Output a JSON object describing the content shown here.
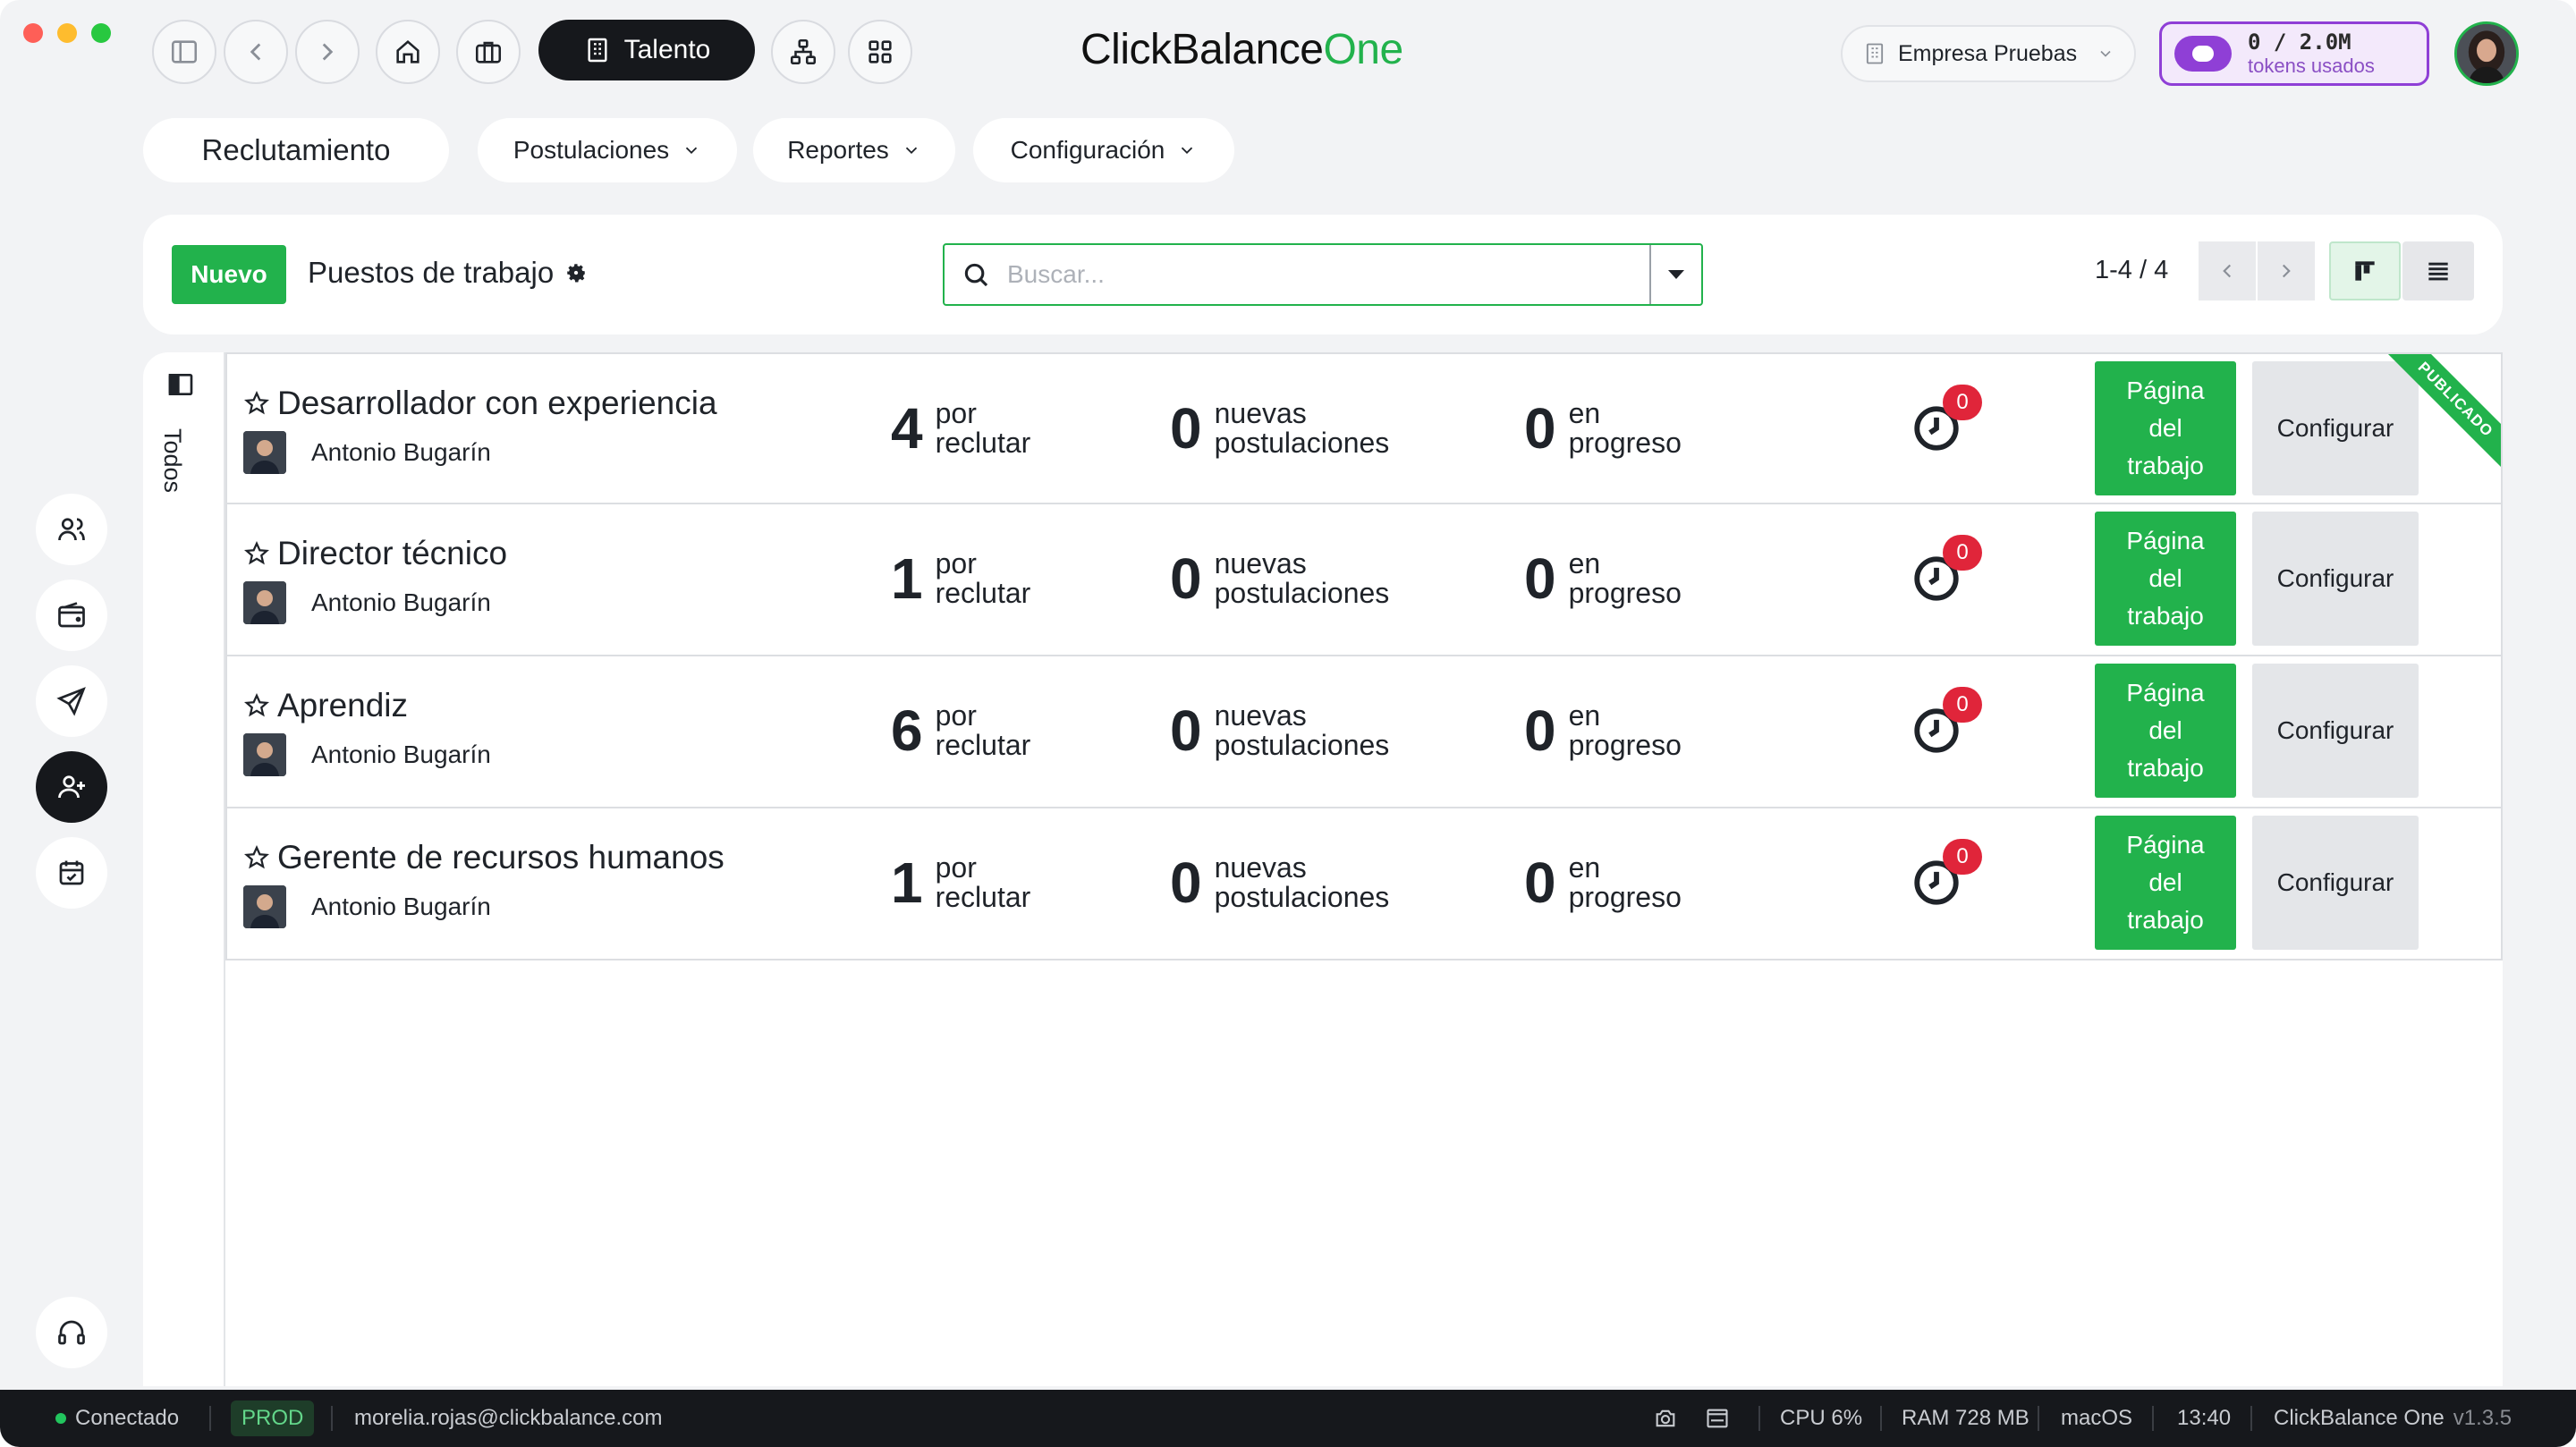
{
  "titlebar": {
    "app_tab_label": "Talento",
    "brand_main": "ClickBalance",
    "brand_suffix": "One",
    "company_name": "Empresa Pruebas",
    "tokens_count": "0 / 2.0M",
    "tokens_label": "tokens usados",
    "icons": [
      "sidebar-toggle-icon",
      "back-arrow-icon",
      "forward-arrow-icon",
      "home-icon",
      "briefcase-icon",
      "building-icon",
      "org-chart-icon",
      "apps-grid-icon",
      "chevron-down-icon"
    ]
  },
  "modulenav": {
    "main": "Reclutamiento",
    "items": [
      {
        "label": "Postulaciones"
      },
      {
        "label": "Reportes"
      },
      {
        "label": "Configuración"
      }
    ]
  },
  "control": {
    "new_button": "Nuevo",
    "breadcrumb": "Puestos de trabajo",
    "search_placeholder": "Buscar...",
    "pager": "1-4 / 4"
  },
  "sidefilter": {
    "label": "Todos"
  },
  "jobs": [
    {
      "title": "Desarrollador con experiencia",
      "recruiter": "Antonio Bugarín",
      "to_recruit": "4",
      "to_recruit_label_1": "por",
      "to_recruit_label_2": "reclutar",
      "new_applications": "0",
      "new_applications_label_1": "nuevas",
      "new_applications_label_2": "postulaciones",
      "in_progress": "0",
      "in_progress_label_1": "en",
      "in_progress_label_2": "progreso",
      "activity_count": "0",
      "page_button_1": "Página",
      "page_button_2": "del",
      "page_button_3": "trabajo",
      "config_button": "Configurar",
      "ribbon": "PUBLICADO"
    },
    {
      "title": "Director técnico",
      "recruiter": "Antonio Bugarín",
      "to_recruit": "1",
      "to_recruit_label_1": "por",
      "to_recruit_label_2": "reclutar",
      "new_applications": "0",
      "new_applications_label_1": "nuevas",
      "new_applications_label_2": "postulaciones",
      "in_progress": "0",
      "in_progress_label_1": "en",
      "in_progress_label_2": "progreso",
      "activity_count": "0",
      "page_button_1": "Página",
      "page_button_2": "del",
      "page_button_3": "trabajo",
      "config_button": "Configurar"
    },
    {
      "title": "Aprendiz",
      "recruiter": "Antonio Bugarín",
      "to_recruit": "6",
      "to_recruit_label_1": "por",
      "to_recruit_label_2": "reclutar",
      "new_applications": "0",
      "new_applications_label_1": "nuevas",
      "new_applications_label_2": "postulaciones",
      "in_progress": "0",
      "in_progress_label_1": "en",
      "in_progress_label_2": "progreso",
      "activity_count": "0",
      "page_button_1": "Página",
      "page_button_2": "del",
      "page_button_3": "trabajo",
      "config_button": "Configurar"
    },
    {
      "title": "Gerente de recursos humanos",
      "recruiter": "Antonio Bugarín",
      "to_recruit": "1",
      "to_recruit_label_1": "por",
      "to_recruit_label_2": "reclutar",
      "new_applications": "0",
      "new_applications_label_1": "nuevas",
      "new_applications_label_2": "postulaciones",
      "in_progress": "0",
      "in_progress_label_1": "en",
      "in_progress_label_2": "progreso",
      "activity_count": "0",
      "page_button_1": "Página",
      "page_button_2": "del",
      "page_button_3": "trabajo",
      "config_button": "Configurar"
    }
  ],
  "rail": {
    "icons": [
      "users-icon",
      "wallet-icon",
      "plane-icon",
      "user-plus-icon",
      "calendar-check-icon",
      "headset-icon"
    ]
  },
  "statusbar": {
    "connection": "Conectado",
    "environment": "PROD",
    "user_email": "morelia.rojas@clickbalance.com",
    "cpu": "CPU 6%",
    "ram": "RAM 728 MB",
    "os": "macOS",
    "time": "13:40",
    "app_name": "ClickBalance One",
    "version": "v1.3.5"
  },
  "colors": {
    "brand_green": "#22b24c",
    "dark": "#16181c",
    "tokens_purple": "#8f3fd6",
    "badge_red": "#e0253a",
    "background": "#f2f3f5"
  }
}
